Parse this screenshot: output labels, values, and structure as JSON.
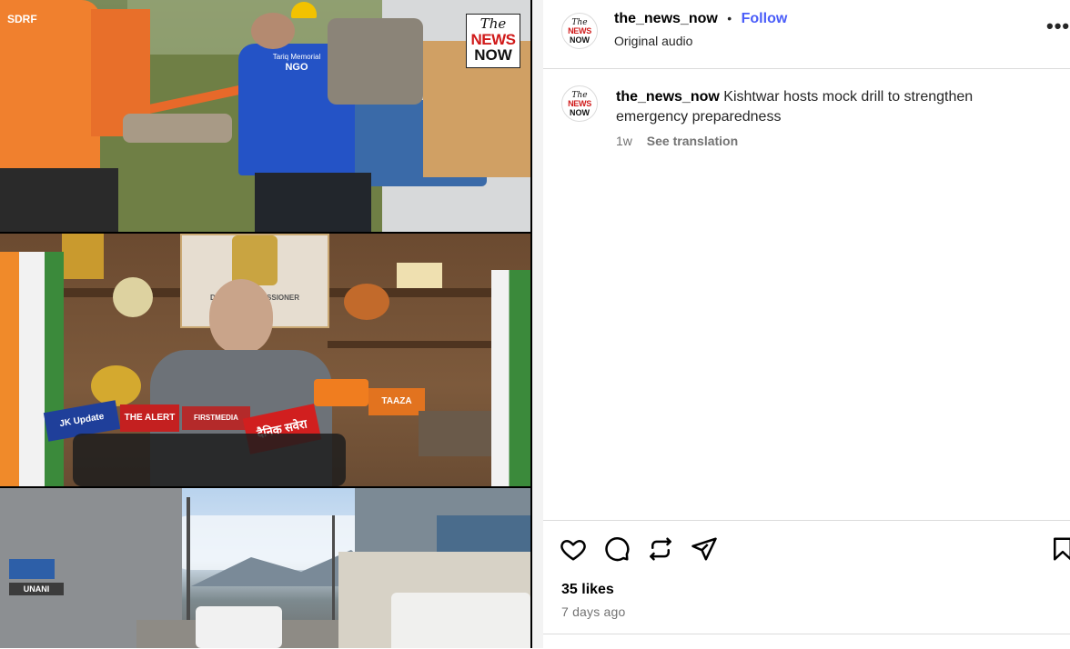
{
  "media": {
    "logo": {
      "the": "The",
      "news": "NEWS",
      "now": "NOW"
    },
    "top_panel": {
      "vest_text_small": "Tariq Memorial",
      "vest_text": "NGO",
      "badge_text": "SDRF"
    },
    "middle_panel": {
      "nameplate": "DEPUTY COMMISSIONER",
      "mic_labels": [
        "JK Update",
        "THE ALERT",
        "FIRSTMEDIA",
        "दैनिक सवेरा",
        "TAAZA"
      ]
    },
    "bottom_panel": {
      "shop_sign": "UNANI"
    }
  },
  "post": {
    "username": "the_news_now",
    "separator": "•",
    "follow_label": "Follow",
    "audio_label": "Original audio",
    "more_label": "•••",
    "caption_username": "the_news_now",
    "caption_text": "Kishtwar hosts mock drill to strengthen emergency preparedness",
    "time_short": "1w",
    "see_translation": "See translation",
    "likes": "35 likes",
    "time_ago": "7 days ago"
  },
  "avatar_text": {
    "the": "The",
    "news": "NEWS",
    "now": "NOW"
  },
  "colors": {
    "follow": "#4a5df9",
    "logo_red": "#d01a1a",
    "divider": "#dbdbdb",
    "muted": "#737373"
  },
  "icons": [
    "heart-icon",
    "comment-icon",
    "repost-icon",
    "share-icon",
    "bookmark-icon"
  ]
}
